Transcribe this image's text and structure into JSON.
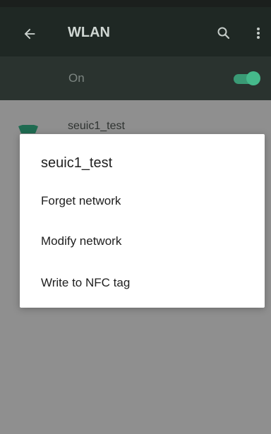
{
  "appbar": {
    "title": "WLAN",
    "back_icon": "arrow-back-icon",
    "search_icon": "search-icon",
    "menu_icon": "more-vert-icon"
  },
  "wifi_toggle": {
    "label": "On",
    "state": "on",
    "accent_color": "#45b98b"
  },
  "network_list": [
    {
      "name": "seuic1_test",
      "icon": "wifi-icon"
    }
  ],
  "dialog": {
    "title": "seuic1_test",
    "options": [
      "Forget network",
      "Modify network",
      "Write to NFC tag"
    ]
  }
}
